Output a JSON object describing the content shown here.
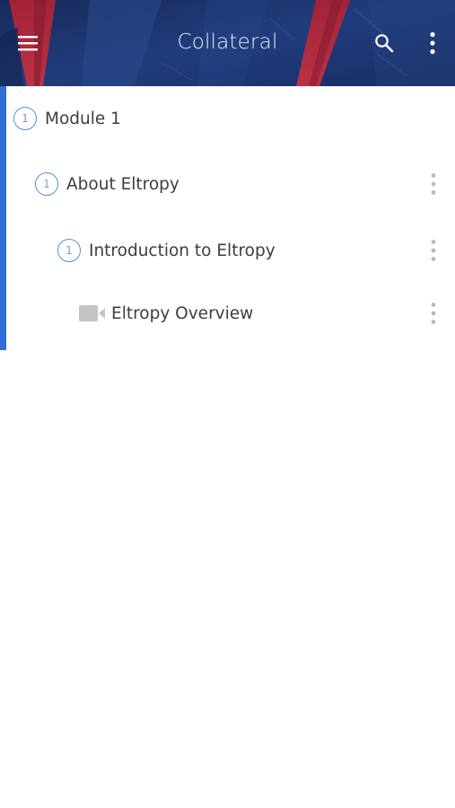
{
  "header": {
    "title": "Collateral",
    "menu_icon": "hamburger-menu-icon",
    "search_icon": "search-icon",
    "more_icon": "more-vertical-icon"
  },
  "tree": {
    "accent_color": "#2f6fd6",
    "items": [
      {
        "badge": "1",
        "label": "Module 1",
        "type": "module"
      },
      {
        "badge": "1",
        "label": "About Eltropy",
        "type": "section"
      },
      {
        "badge": "1",
        "label": "Introduction to Eltropy",
        "type": "topic"
      },
      {
        "badge": "",
        "label": "Eltropy Overview",
        "type": "video",
        "icon": "video-camera-icon"
      }
    ]
  }
}
